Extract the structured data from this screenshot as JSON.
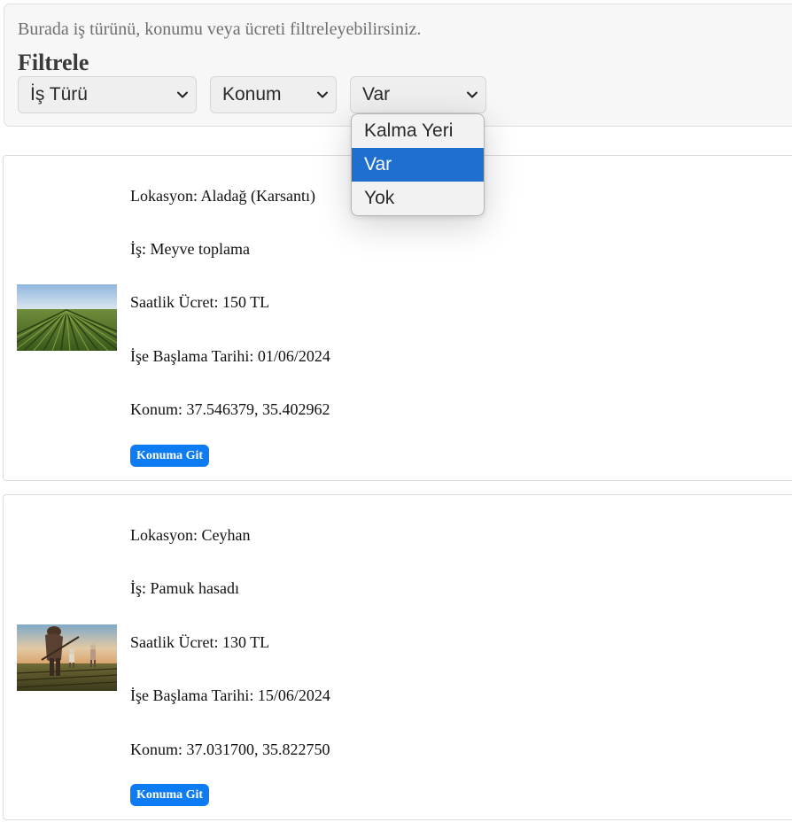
{
  "filter": {
    "description": "Burada iş türünü, konumu veya ücreti filtreleyebilirsiniz.",
    "title": "Filtrele",
    "job_type_select": "İş Türü",
    "location_select": "Konum",
    "lodging_select": "Var",
    "lodging_options": [
      "Kalma Yeri",
      "Var",
      "Yok"
    ],
    "lodging_selected": "Var"
  },
  "jobs": [
    {
      "location": "Lokasyon: Aladağ (Karsantı)",
      "job": "İş: Meyve toplama",
      "wage": "Saatlik Ücret: 150 TL",
      "start_date": "İşe Başlama Tarihi: 01/06/2024",
      "coordinates": "Konum: 37.546379, 35.402962",
      "button": "Konuma Git"
    },
    {
      "location": "Lokasyon: Ceyhan",
      "job": "İş: Pamuk hasadı",
      "wage": "Saatlik Ücret: 130 TL",
      "start_date": "İşe Başlama Tarihi: 15/06/2024",
      "coordinates": "Konum: 37.031700, 35.822750",
      "button": "Konuma Git"
    }
  ],
  "colors": {
    "accent": "#0d7cf2",
    "dropdown_highlight": "#1f6fd1"
  }
}
